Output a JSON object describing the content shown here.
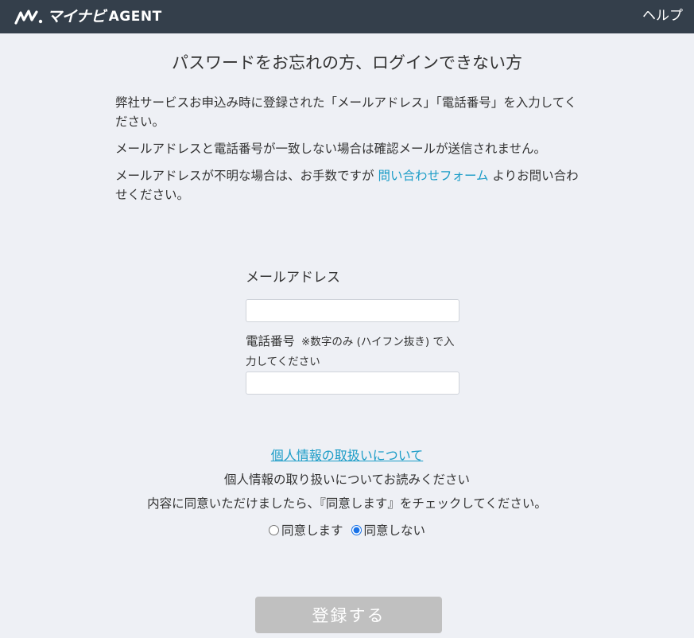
{
  "header": {
    "logo_kana": "マイナビ",
    "logo_agent": "AGENT",
    "help_label": "ヘルプ",
    "bg_color": "#343f4b"
  },
  "page": {
    "title": "パスワードをお忘れの方、ログインできない方"
  },
  "intro": {
    "line1": "弊社サービスお申込み時に登録された「メールアドレス」「電話番号」を入力してください。",
    "line2": "メールアドレスと電話番号が一致しない場合は確認メールが送信されません。",
    "line3_before": "メールアドレスが不明な場合は、お手数ですが ",
    "line3_link": "問い合わせフォーム",
    "line3_after": " よりお問い合わせください。"
  },
  "form": {
    "email_label": "メールアドレス",
    "email_value": "",
    "phone_label": "電話番号",
    "phone_note": "※数字のみ (ハイフン抜き) で入力してください",
    "phone_value": ""
  },
  "privacy": {
    "link_text": "個人情報の取扱いについて",
    "read_text": "個人情報の取り扱いについてお読みください",
    "instruction": "内容に同意いただけましたら、『同意します』をチェックしてください。"
  },
  "agreement": {
    "agree_label": "同意します",
    "disagree_label": "同意しない",
    "selected": "同意しない"
  },
  "submit": {
    "label": "登録する",
    "disabled": true,
    "color": "#c0c0c0"
  },
  "colors": {
    "accent_link": "#1a9cc7",
    "page_bg": "#eef0f5"
  },
  "icons": {
    "logo_mark": "mynavi-logo-icon"
  }
}
